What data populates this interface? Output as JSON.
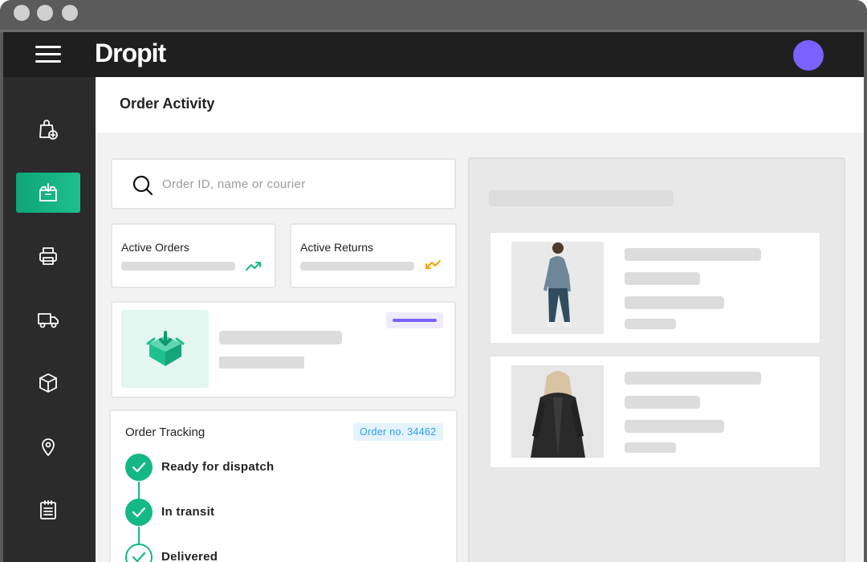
{
  "app": {
    "logo_text": "Dropit",
    "colors": {
      "accent_green": "#14b886",
      "accent_purple": "#7b61ff",
      "badge_blue": "#2ca0e8",
      "appbar": "#1f1f1f",
      "sidebar": "#2b2b2b"
    }
  },
  "sidebar": {
    "items": [
      {
        "icon": "shopping-bag-add-icon",
        "active": false
      },
      {
        "icon": "box-download-icon",
        "active": true
      },
      {
        "icon": "printer-icon",
        "active": false
      },
      {
        "icon": "truck-icon",
        "active": false
      },
      {
        "icon": "package-icon",
        "active": false
      },
      {
        "icon": "location-pin-icon",
        "active": false
      },
      {
        "icon": "clipboard-list-icon",
        "active": false
      }
    ]
  },
  "page": {
    "title": "Order Activity"
  },
  "search": {
    "value": "",
    "placeholder": "Order ID, name or courier"
  },
  "stats": [
    {
      "label": "Active Orders",
      "trend": "up",
      "trend_color": "#14b886"
    },
    {
      "label": "Active Returns",
      "trend": "down",
      "trend_color": "#f0a30a"
    }
  ],
  "tracking": {
    "title": "Order Tracking",
    "order_badge": "Order no. 34462",
    "steps": [
      {
        "label": "Ready for dispatch",
        "status": "done"
      },
      {
        "label": "In transit",
        "status": "done"
      },
      {
        "label": "Delivered",
        "status": "pending"
      }
    ]
  },
  "products": [
    {
      "photo": "person-in-denim-outfit"
    },
    {
      "photo": "person-in-black-coat"
    }
  ]
}
